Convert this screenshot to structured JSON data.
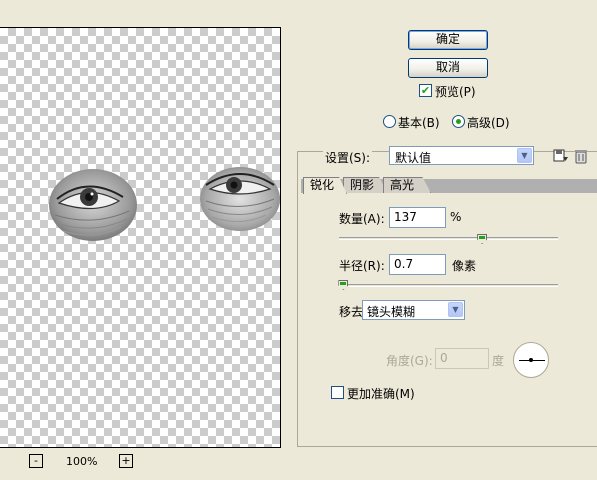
{
  "preview": {
    "zoom_label": "100%",
    "zoom_out": "-",
    "zoom_in": "+"
  },
  "buttons": {
    "ok": "确定",
    "cancel": "取消"
  },
  "preview_checkbox": {
    "label": "预览(P)",
    "checked": true
  },
  "mode": {
    "basic_label": "基本(B)",
    "advanced_label": "高级(D)",
    "selected": "advanced"
  },
  "settings": {
    "label": "设置(S):",
    "value": "默认值"
  },
  "tabs": [
    {
      "label": "锐化",
      "active": true
    },
    {
      "label": "阴影",
      "active": false
    },
    {
      "label": "高光",
      "active": false
    }
  ],
  "amount": {
    "label": "数量(A):",
    "value": "137",
    "unit": "%",
    "slider_fraction": 0.34
  },
  "radius": {
    "label": "半径(R):",
    "value": "0.7",
    "unit": "像素",
    "slider_fraction": 0.02
  },
  "remove": {
    "label": "移去(V):",
    "value": "镜头模糊"
  },
  "angle": {
    "label": "角度(G):",
    "value": "0",
    "unit": "度"
  },
  "more_accurate": {
    "label": "更加准确(M)",
    "checked": false
  },
  "icons": {
    "save": "save-settings-icon",
    "delete": "delete-settings-icon"
  },
  "colors": {
    "accent_green": "#21a121",
    "window_bg": "#ece9d8",
    "border_blue": "#7f9db9"
  }
}
